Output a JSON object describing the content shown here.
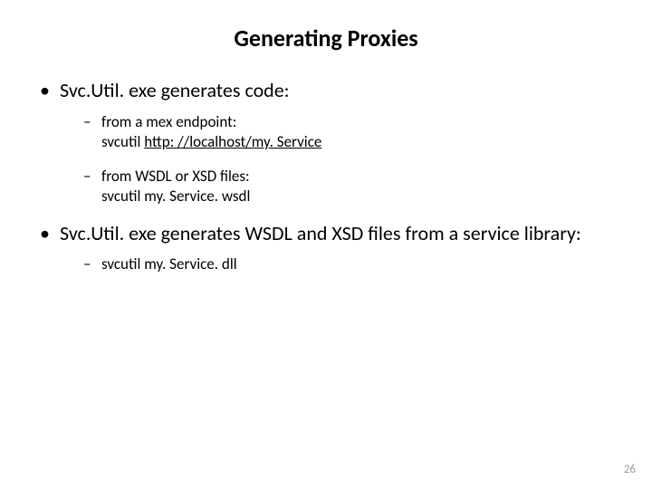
{
  "title": "Generating Proxies",
  "bullets": [
    {
      "text": "Svc.Util. exe generates code:",
      "sub": [
        {
          "line1": "from a mex endpoint:",
          "prefix": "svcutil ",
          "underlined": "http: //localhost/my. Service"
        },
        {
          "line1": "from WSDL or XSD files:",
          "line2": "svcutil my. Service. wsdl"
        }
      ]
    },
    {
      "text": "Svc.Util. exe generates WSDL and XSD files from a service library:",
      "sub": [
        {
          "line1": "svcutil my. Service. dll"
        }
      ]
    }
  ],
  "page_number": "26"
}
